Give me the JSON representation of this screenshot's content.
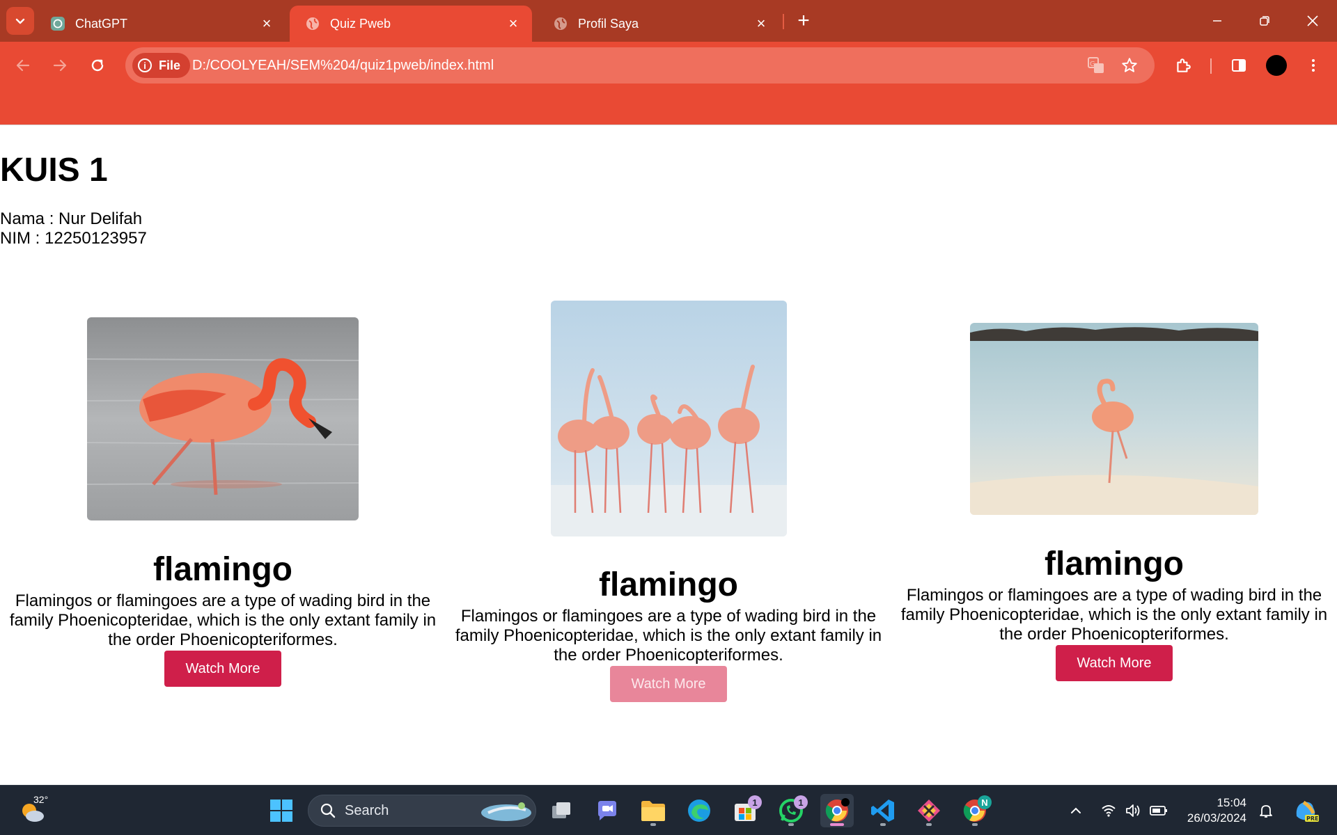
{
  "browser": {
    "tabs": [
      {
        "title": "ChatGPT",
        "icon": "chatgpt-icon",
        "active": false
      },
      {
        "title": "Quiz Pweb",
        "icon": "globe-icon",
        "active": true
      },
      {
        "title": "Profil Saya",
        "icon": "globe-icon",
        "active": false
      }
    ],
    "address": {
      "chip_label": "File",
      "url": "D:/COOLYEAH/SEM%204/quiz1pweb/index.html"
    },
    "colors": {
      "tabbar": "#a83a24",
      "toolbar": "#e94a34"
    }
  },
  "page": {
    "title": "KUIS 1",
    "nama": "Nama : Nur Delifah",
    "nim": "NIM : 12250123957",
    "cards": [
      {
        "title": "flamingo",
        "description": "Flamingos or flamingoes are a type of wading bird in the family Phoenicopteridae, which is the only extant family in the order Phoenicopteriformes.",
        "button": "Watch More"
      },
      {
        "title": "flamingo",
        "description": "Flamingos or flamingoes are a type of wading bird in the family Phoenicopteridae, which is the only extant family in the order Phoenicopteriformes.",
        "button": "Watch More"
      },
      {
        "title": "flamingo",
        "description": "Flamingos or flamingoes are a type of wading bird in the family Phoenicopteridae, which is the only extant family in the order Phoenicopteriformes.",
        "button": "Watch More"
      }
    ],
    "button_color": "#cf1f4a"
  },
  "taskbar": {
    "weather_temp": "32°",
    "search_placeholder": "Search",
    "store_badge": "1",
    "whatsapp_badge": "1",
    "chrome_profile_badge": "N",
    "time": "15:04",
    "date": "26/03/2024"
  }
}
